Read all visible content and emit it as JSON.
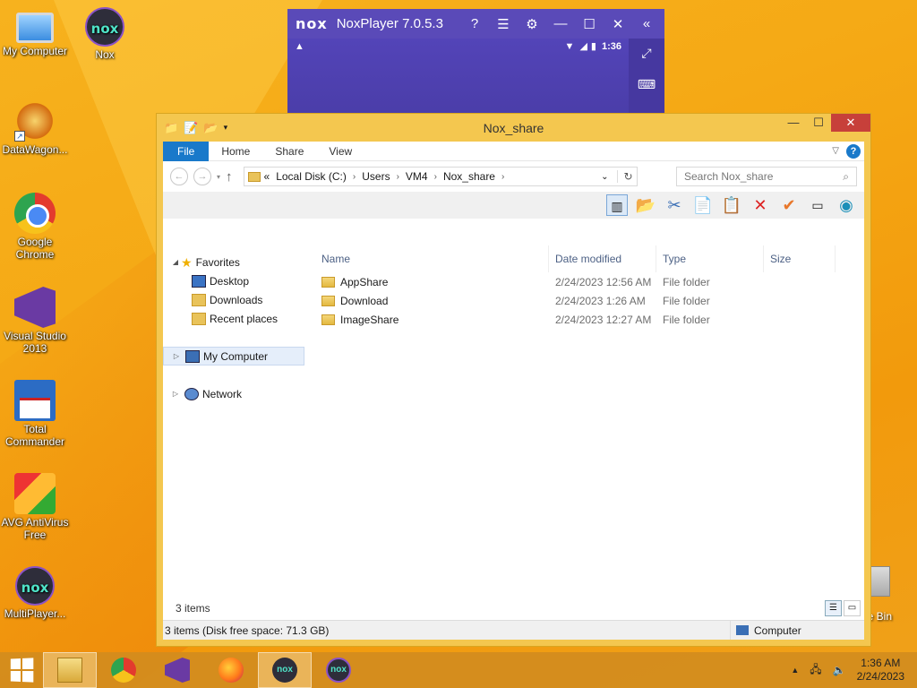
{
  "desktop": {
    "icons": [
      {
        "label": "My Computer"
      },
      {
        "label": "Nox"
      },
      {
        "label": "DataWagon..."
      },
      {
        "label": "Google Chrome"
      },
      {
        "label": "Visual Studio 2013"
      },
      {
        "label": "Total Commander"
      },
      {
        "label": "AVG AntiVirus Free"
      },
      {
        "label": "MultiPlayer..."
      }
    ],
    "recycle_bin_label": "cle Bin",
    "nox_logo_text": "nox"
  },
  "nox_player": {
    "logo": "nox",
    "title": "NoxPlayer 7.0.5.3",
    "status_time": "1:36"
  },
  "explorer": {
    "title": "Nox_share",
    "ribbon_tabs": [
      "File",
      "Home",
      "Share",
      "View"
    ],
    "help": "?",
    "address": {
      "prefix": "«",
      "crumbs": [
        "Local Disk (C:)",
        "Users",
        "VM4",
        "Nox_share"
      ]
    },
    "search_placeholder": "Search Nox_share",
    "nav": {
      "favorites": "Favorites",
      "desktop": "Desktop",
      "downloads": "Downloads",
      "recent": "Recent places",
      "my_computer": "My Computer",
      "network": "Network"
    },
    "columns": {
      "name": "Name",
      "date": "Date modified",
      "type": "Type",
      "size": "Size"
    },
    "files": [
      {
        "name": "AppShare",
        "date": "2/24/2023 12:56 AM",
        "type": "File folder",
        "size": ""
      },
      {
        "name": "Download",
        "date": "2/24/2023 1:26 AM",
        "type": "File folder",
        "size": ""
      },
      {
        "name": "ImageShare",
        "date": "2/24/2023 12:27 AM",
        "type": "File folder",
        "size": ""
      }
    ],
    "item_count": "3 items",
    "status_left": "3 items (Disk free space: 71.3 GB)",
    "status_right": "Computer"
  },
  "taskbar": {
    "time": "1:36 AM",
    "date": "2/24/2023",
    "nox_text": "nox"
  },
  "colors": {
    "accent": "#1979ca",
    "desktop": "#f5a915",
    "nox_purple": "#4b3fa7"
  }
}
